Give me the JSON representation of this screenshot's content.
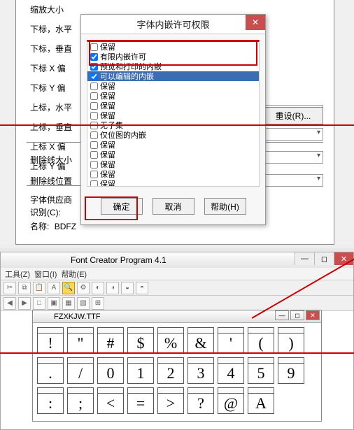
{
  "bg_form": {
    "labels": [
      "缩放大小",
      "下标，水平",
      "下标，垂直",
      "下标 X 偏",
      "下标 Y 偏",
      "上标，水平",
      "上标，垂直",
      "上标 X 偏",
      "上标 Y 偏",
      "删除线大小",
      "删除线位置",
      "字体供应商",
      "识别(C):",
      "名称:"
    ],
    "name_value": "BDFZ",
    "reset_btn": "重设(R)..."
  },
  "dialog": {
    "title": "字体内嵌许可权限",
    "items": [
      {
        "label": "保留",
        "checked": false
      },
      {
        "label": "有限内嵌许可",
        "checked": true
      },
      {
        "label": "预览和打印的内嵌",
        "checked": true
      },
      {
        "label": "可以编辑的内嵌",
        "checked": true,
        "selected": true
      },
      {
        "label": "保留",
        "checked": false
      },
      {
        "label": "保留",
        "checked": false
      },
      {
        "label": "保留",
        "checked": false
      },
      {
        "label": "保留",
        "checked": false
      },
      {
        "label": "无子集",
        "checked": false
      },
      {
        "label": "仅位图的内嵌",
        "checked": false
      },
      {
        "label": "保留",
        "checked": false
      },
      {
        "label": "保留",
        "checked": false
      },
      {
        "label": "保留",
        "checked": false
      },
      {
        "label": "保留",
        "checked": false
      },
      {
        "label": "保留",
        "checked": false
      }
    ],
    "ok": "确定",
    "cancel": "取消",
    "help": "帮助(H)"
  },
  "app": {
    "title": "Font Creator Program 4.1",
    "menu": [
      "工具(Z)",
      "窗口(I)",
      "帮助(E)"
    ],
    "glyph_title": "FZXKJW.TTF",
    "glyphs_row1": [
      "!",
      "\"",
      "#",
      "$",
      "%",
      "&",
      "'",
      "(",
      ")"
    ],
    "glyphs_row2": [
      ".",
      "/",
      "0",
      "1",
      "2",
      "3",
      "4",
      "5"
    ],
    "glyphs_row3": [
      "9",
      ":",
      ";",
      "<",
      "=",
      ">",
      "?",
      "@",
      "A"
    ]
  }
}
